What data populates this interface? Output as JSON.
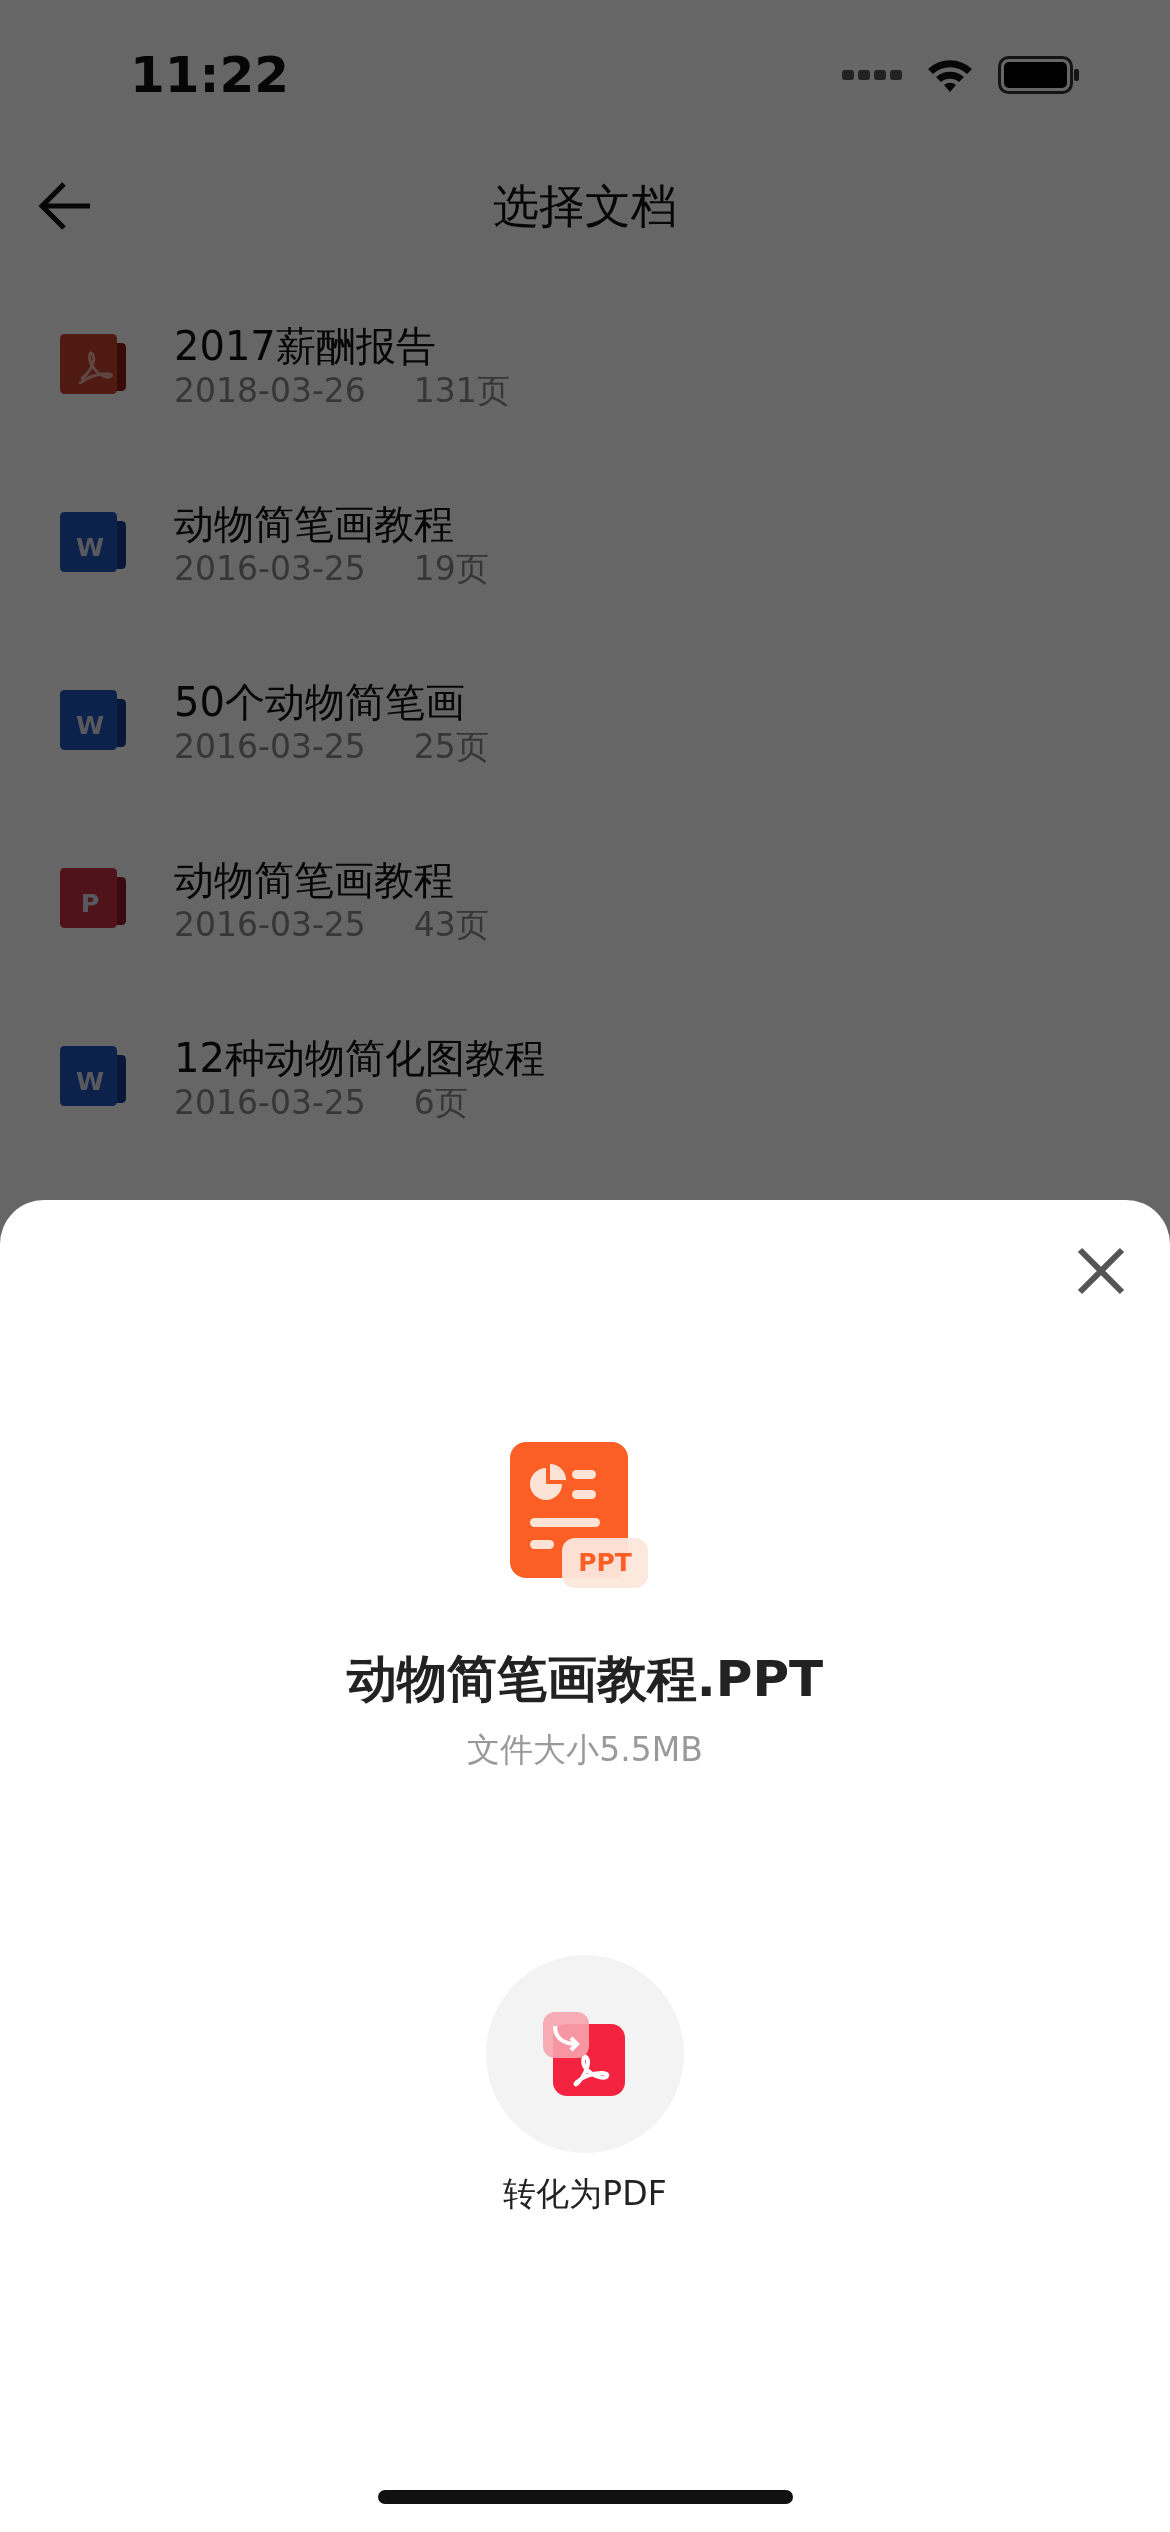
{
  "status_bar": {
    "time": "11:22"
  },
  "nav": {
    "title": "选择文档"
  },
  "documents": [
    {
      "kind": "pdf",
      "name": "2017薪酬报告",
      "date": "2018-03-26",
      "pages": "131页"
    },
    {
      "kind": "word",
      "glyph": "W",
      "name": "动物简笔画教程",
      "date": "2016-03-25",
      "pages": "19页"
    },
    {
      "kind": "word",
      "glyph": "W",
      "name": "50个动物简笔画",
      "date": "2016-03-25",
      "pages": "25页"
    },
    {
      "kind": "ppt",
      "glyph": "P",
      "name": "动物简笔画教程",
      "date": "2016-03-25",
      "pages": "43页"
    },
    {
      "kind": "word",
      "glyph": "W",
      "name": "12种动物简化图教程",
      "date": "2016-03-25",
      "pages": "6页"
    }
  ],
  "sheet": {
    "file": {
      "kind": "ppt",
      "badge": "PPT",
      "name": "动物简笔画教程.PPT",
      "size": "文件大小5.5MB"
    },
    "actions": [
      {
        "label": "转化为PDF"
      }
    ]
  }
}
